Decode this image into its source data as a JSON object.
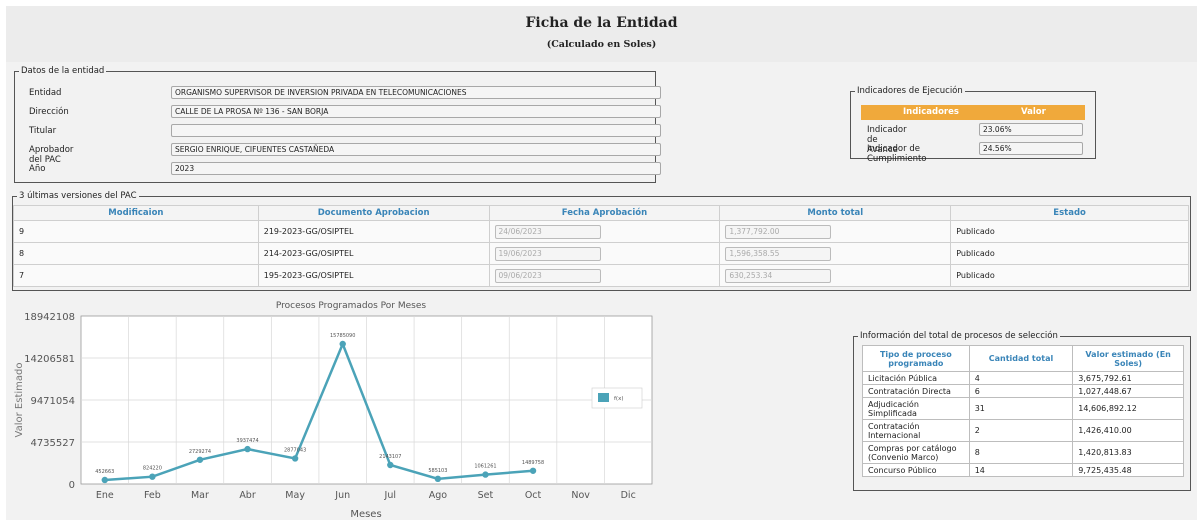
{
  "header": {
    "title": "Ficha de la Entidad",
    "subtitle": "(Calculado en Soles)"
  },
  "entity": {
    "legend": "Datos de la entidad",
    "fields": [
      {
        "label": "Entidad",
        "value": "ORGANISMO SUPERVISOR DE INVERSION PRIVADA EN TELECOMUNICACIONES"
      },
      {
        "label": "Dirección",
        "value": "CALLE DE LA PROSA Nº 136 - SAN BORJA"
      },
      {
        "label": "Titular",
        "value": ""
      },
      {
        "label": "Aprobador del PAC",
        "value": "SERGIO ENRIQUE, CIFUENTES CASTAÑEDA"
      },
      {
        "label": "Año",
        "value": "2023"
      }
    ]
  },
  "indicators": {
    "legend": "Indicadores de Ejecución",
    "col_indicator": "Indicadores",
    "col_value": "Valor",
    "rows": [
      {
        "label": "Indicador de Avance",
        "value": "23.06%"
      },
      {
        "label": "Indicador de Cumplimiento",
        "value": "24.56%"
      }
    ],
    "header_color": "#f0a93b"
  },
  "pac_versions": {
    "legend": "3 últimas versiones del PAC",
    "headers": [
      "Modificaion",
      "Documento Aprobacion",
      "Fecha Aprobación",
      "Monto total",
      "Estado"
    ],
    "rows": [
      {
        "mod": "9",
        "doc": "219-2023-GG/OSIPTEL",
        "fecha": "24/06/2023",
        "monto": "1,377,792.00",
        "estado": "Publicado"
      },
      {
        "mod": "8",
        "doc": "214-2023-GG/OSIPTEL",
        "fecha": "19/06/2023",
        "monto": "1,596,358.55",
        "estado": "Publicado"
      },
      {
        "mod": "7",
        "doc": "195-2023-GG/OSIPTEL",
        "fecha": "09/06/2023",
        "monto": "630,253.34",
        "estado": "Publicado"
      }
    ]
  },
  "totals": {
    "legend": "Información del total de procesos de selección",
    "headers": [
      "Tipo de proceso programado",
      "Cantidad total",
      "Valor estimado (En Soles)"
    ],
    "rows": [
      {
        "tipo": "Licitación Pública",
        "cantidad": "4",
        "valor": "3,675,792.61"
      },
      {
        "tipo": "Contratación Directa",
        "cantidad": "6",
        "valor": "1,027,448.67"
      },
      {
        "tipo": "Adjudicación Simplificada",
        "cantidad": "31",
        "valor": "14,606,892.12"
      },
      {
        "tipo": "Contratación Internacional",
        "cantidad": "2",
        "valor": "1,426,410.00"
      },
      {
        "tipo": "Compras por catálogo (Convenio Marco)",
        "cantidad": "8",
        "valor": "1,420,813.83"
      },
      {
        "tipo": "Concurso Público",
        "cantidad": "14",
        "valor": "9,725,435.48"
      }
    ]
  },
  "chart_data": {
    "type": "line",
    "title": "Procesos Programados Por Meses",
    "xlabel": "Meses",
    "ylabel": "Valor Estimado",
    "categories": [
      "Ene",
      "Feb",
      "Mar",
      "Abr",
      "May",
      "Jun",
      "Jul",
      "Ago",
      "Set",
      "Oct",
      "Nov",
      "Dic"
    ],
    "yticks": [
      "0",
      "4735527",
      "9471054",
      "14206581",
      "18942108"
    ],
    "ylim": [
      0,
      18942108
    ],
    "legend_position": "right",
    "grid": true,
    "series": [
      {
        "name": "f(x)",
        "color": "#4ba3b8",
        "values": [
          452663,
          824220,
          2729274,
          3937474,
          2877043,
          15785090,
          2143107,
          585103,
          1061261,
          1489758
        ],
        "labels": [
          "452663",
          "824220",
          "2729274",
          "3937474",
          "2877043",
          "15785090",
          "2143107",
          "585103",
          "1061261",
          "1489758"
        ]
      }
    ]
  }
}
